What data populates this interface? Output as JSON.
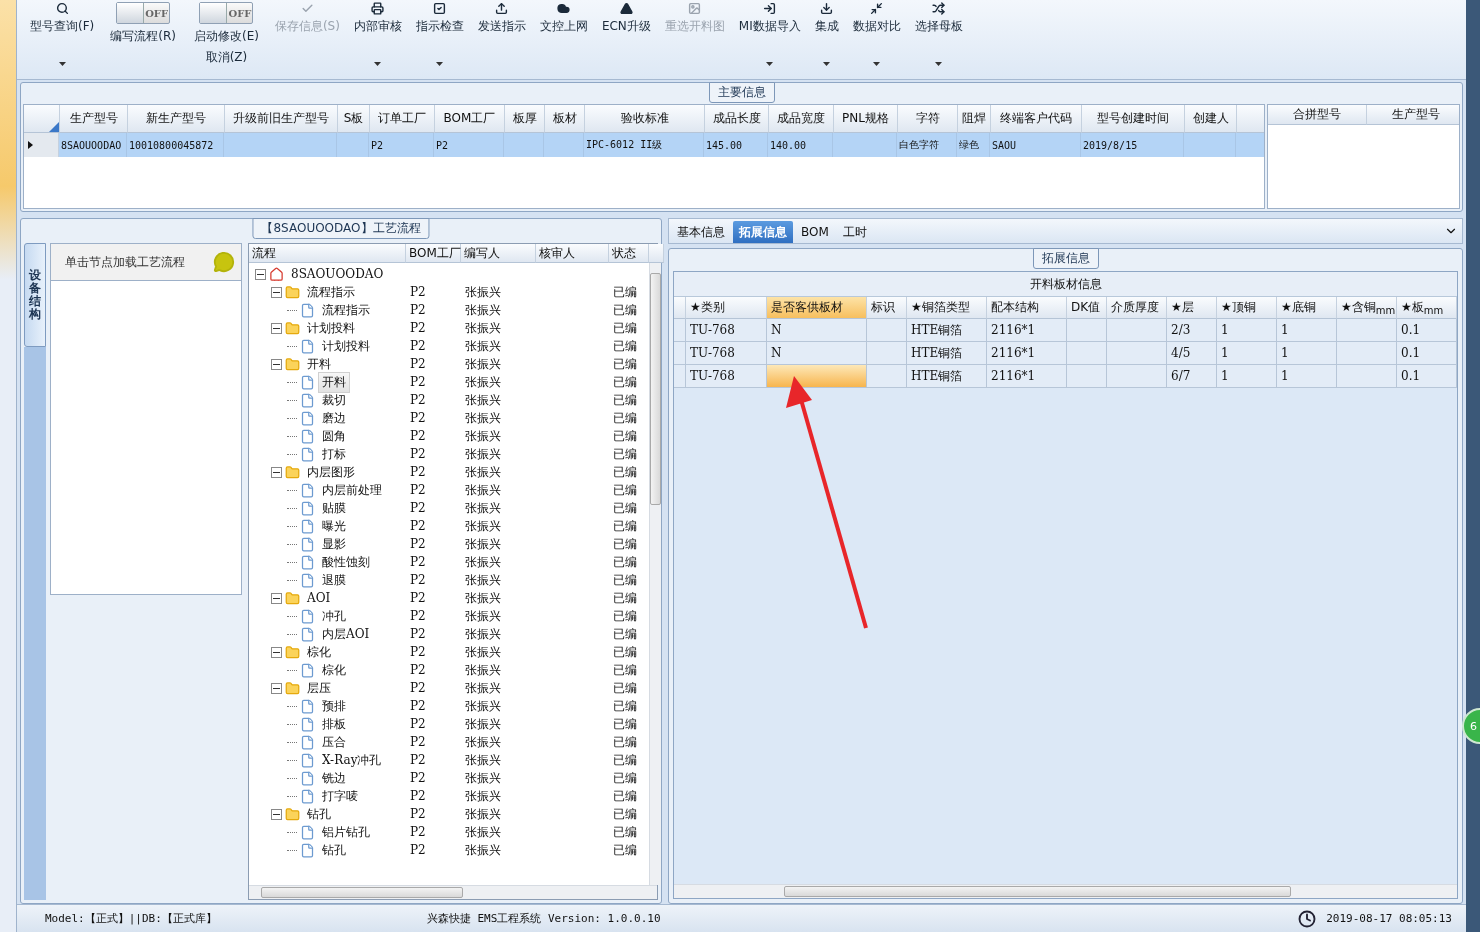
{
  "toolbar": [
    {
      "kind": "button",
      "label": "型号查询(F)",
      "disabled": false,
      "dropdown": true
    },
    {
      "kind": "toggle",
      "switch": "OFF",
      "on": false,
      "label": "编写流程(R)"
    },
    {
      "kind": "toggle",
      "switch": "OFF",
      "on": false,
      "label": "启动修改(E)",
      "label2": "取消(Z)"
    },
    {
      "kind": "button",
      "label": "保存信息(S)",
      "disabled": true,
      "dropdown": false
    },
    {
      "kind": "button",
      "label": "内部审核",
      "disabled": false,
      "dropdown": true
    },
    {
      "kind": "button",
      "label": "指示检查",
      "disabled": false,
      "dropdown": true
    },
    {
      "kind": "button",
      "label": "发送指示",
      "disabled": false,
      "dropdown": false
    },
    {
      "kind": "button",
      "label": "文控上网",
      "disabled": false,
      "dropdown": false
    },
    {
      "kind": "button",
      "label": "ECN升级",
      "disabled": false,
      "dropdown": false
    },
    {
      "kind": "button",
      "label": "重选开料图",
      "disabled": true,
      "dropdown": false
    },
    {
      "kind": "button",
      "label": "MI数据导入",
      "disabled": false,
      "dropdown": true
    },
    {
      "kind": "button",
      "label": "集成",
      "disabled": false,
      "dropdown": true
    },
    {
      "kind": "button",
      "label": "数据对比",
      "disabled": false,
      "dropdown": true
    },
    {
      "kind": "button",
      "label": "选择母板",
      "disabled": false,
      "dropdown": true
    }
  ],
  "main_info": {
    "title": "主要信息",
    "columns": [
      "生产型号",
      "新生产型号",
      "升级前旧生产型号",
      "S板",
      "订单工厂",
      "BOM工厂",
      "板厚",
      "板材",
      "验收标准",
      "成品长度",
      "成品宽度",
      "PNL规格",
      "字符",
      "阻焊",
      "终端客户代码",
      "型号创建时间",
      "创建人"
    ],
    "rows": [
      {
        "selected": true,
        "cells": [
          "8SAOUOODAO",
          "10010800045872",
          null,
          null,
          "P2",
          "P2",
          null,
          null,
          "IPC-6012 II级",
          "145.00",
          "140.00",
          null,
          "白色字符",
          "绿色",
          "SAOU",
          "2019/8/15",
          null
        ]
      }
    ],
    "side_table": {
      "columns": [
        "合拼型号",
        "生产型号"
      ]
    }
  },
  "process": {
    "title": "【8SAOUOODAO】工艺流程",
    "side_tab": {
      "label": "设备结构",
      "selected": true
    },
    "hint": "单击节点加载工艺流程",
    "columns": [
      "流程",
      "BOM工厂",
      "编写人",
      "核审人",
      "状态"
    ],
    "tree": [
      {
        "kind": "root",
        "name": "8SAOUOODAO",
        "expanded": true,
        "selected": false,
        "children": [
          {
            "kind": "folder",
            "name": "流程指示",
            "bom": "P2",
            "author": "张振兴",
            "status": "已编",
            "expanded": true,
            "selected": false,
            "children": [
              {
                "kind": "file",
                "name": "流程指示",
                "bom": "P2",
                "author": "张振兴",
                "status": "已编",
                "selected": false
              }
            ]
          },
          {
            "kind": "folder",
            "name": "计划投料",
            "bom": "P2",
            "author": "张振兴",
            "status": "已编",
            "expanded": true,
            "selected": false,
            "children": [
              {
                "kind": "file",
                "name": "计划投料",
                "bom": "P2",
                "author": "张振兴",
                "status": "已编",
                "selected": false
              }
            ]
          },
          {
            "kind": "folder",
            "name": "开料",
            "bom": "P2",
            "author": "张振兴",
            "status": "已编",
            "expanded": true,
            "selected": false,
            "children": [
              {
                "kind": "file",
                "name": "开料",
                "bom": "P2",
                "author": "张振兴",
                "status": "已编",
                "selected": true
              },
              {
                "kind": "file",
                "name": "裁切",
                "bom": "P2",
                "author": "张振兴",
                "status": "已编",
                "selected": false
              },
              {
                "kind": "file",
                "name": "磨边",
                "bom": "P2",
                "author": "张振兴",
                "status": "已编",
                "selected": false
              },
              {
                "kind": "file",
                "name": "圆角",
                "bom": "P2",
                "author": "张振兴",
                "status": "已编",
                "selected": false
              },
              {
                "kind": "file",
                "name": "打标",
                "bom": "P2",
                "author": "张振兴",
                "status": "已编",
                "selected": false
              }
            ]
          },
          {
            "kind": "folder",
            "name": "内层图形",
            "bom": "P2",
            "author": "张振兴",
            "status": "已编",
            "expanded": true,
            "selected": false,
            "children": [
              {
                "kind": "file",
                "name": "内层前处理",
                "bom": "P2",
                "author": "张振兴",
                "status": "已编",
                "selected": false
              },
              {
                "kind": "file",
                "name": "贴膜",
                "bom": "P2",
                "author": "张振兴",
                "status": "已编",
                "selected": false
              },
              {
                "kind": "file",
                "name": "曝光",
                "bom": "P2",
                "author": "张振兴",
                "status": "已编",
                "selected": false
              },
              {
                "kind": "file",
                "name": "显影",
                "bom": "P2",
                "author": "张振兴",
                "status": "已编",
                "selected": false
              },
              {
                "kind": "file",
                "name": "酸性蚀刻",
                "bom": "P2",
                "author": "张振兴",
                "status": "已编",
                "selected": false
              },
              {
                "kind": "file",
                "name": "退膜",
                "bom": "P2",
                "author": "张振兴",
                "status": "已编",
                "selected": false
              }
            ]
          },
          {
            "kind": "folder",
            "name": "AOI",
            "bom": "P2",
            "author": "张振兴",
            "status": "已编",
            "expanded": true,
            "selected": false,
            "children": [
              {
                "kind": "file",
                "name": "冲孔",
                "bom": "P2",
                "author": "张振兴",
                "status": "已编",
                "selected": false
              },
              {
                "kind": "file",
                "name": "内层AOI",
                "bom": "P2",
                "author": "张振兴",
                "status": "已编",
                "selected": false
              }
            ]
          },
          {
            "kind": "folder",
            "name": "棕化",
            "bom": "P2",
            "author": "张振兴",
            "status": "已编",
            "expanded": true,
            "selected": false,
            "children": [
              {
                "kind": "file",
                "name": "棕化",
                "bom": "P2",
                "author": "张振兴",
                "status": "已编",
                "selected": false
              }
            ]
          },
          {
            "kind": "folder",
            "name": "层压",
            "bom": "P2",
            "author": "张振兴",
            "status": "已编",
            "expanded": true,
            "selected": false,
            "children": [
              {
                "kind": "file",
                "name": "预排",
                "bom": "P2",
                "author": "张振兴",
                "status": "已编",
                "selected": false
              },
              {
                "kind": "file",
                "name": "排板",
                "bom": "P2",
                "author": "张振兴",
                "status": "已编",
                "selected": false
              },
              {
                "kind": "file",
                "name": "压合",
                "bom": "P2",
                "author": "张振兴",
                "status": "已编",
                "selected": false
              },
              {
                "kind": "file",
                "name": "X-Ray冲孔",
                "bom": "P2",
                "author": "张振兴",
                "status": "已编",
                "selected": false
              },
              {
                "kind": "file",
                "name": "铣边",
                "bom": "P2",
                "author": "张振兴",
                "status": "已编",
                "selected": false
              },
              {
                "kind": "file",
                "name": "打字唛",
                "bom": "P2",
                "author": "张振兴",
                "status": "已编",
                "selected": false
              }
            ]
          },
          {
            "kind": "folder",
            "name": "钻孔",
            "bom": "P2",
            "author": "张振兴",
            "status": "已编",
            "expanded": true,
            "selected": false,
            "children": [
              {
                "kind": "file",
                "name": "铝片钻孔",
                "bom": "P2",
                "author": "张振兴",
                "status": "已编",
                "selected": false
              },
              {
                "kind": "file",
                "name": "钻孔",
                "bom": "P2",
                "author": "张振兴",
                "status": "已编",
                "selected": false
              }
            ]
          }
        ]
      }
    ]
  },
  "detail": {
    "tabs": [
      {
        "label": "基本信息",
        "selected": false
      },
      {
        "label": "拓展信息",
        "selected": true
      },
      {
        "label": "BOM",
        "selected": false
      },
      {
        "label": "工时",
        "selected": false
      }
    ],
    "group_title": "拓展信息",
    "table_title": "开料板材信息",
    "columns": [
      {
        "label": "★类别",
        "selected": false
      },
      {
        "label": "是否客供板材",
        "selected": true
      },
      {
        "label": "标识",
        "selected": false
      },
      {
        "label": "★铜箔类型",
        "selected": false
      },
      {
        "label": "配本结构",
        "selected": false
      },
      {
        "label": "DK值",
        "selected": false
      },
      {
        "label": "介质厚度",
        "selected": false
      },
      {
        "label": "★层",
        "selected": false
      },
      {
        "label": "★顶铜",
        "selected": false
      },
      {
        "label": "★底铜",
        "selected": false
      },
      {
        "label": "★含铜$_{mm}$",
        "selected": false
      },
      {
        "label": "★板$_{mm}$",
        "selected": false
      }
    ],
    "rows": [
      {
        "selected": false,
        "cells": [
          "TU-768",
          "N",
          null,
          "HTE铜箔",
          "2116*1",
          null,
          null,
          "2/3",
          "1",
          "1",
          null,
          "0.1"
        ]
      },
      {
        "selected": false,
        "cells": [
          "TU-768",
          "N",
          null,
          "HTE铜箔",
          "2116*1",
          null,
          null,
          "4/5",
          "1",
          "1",
          null,
          "0.1"
        ]
      },
      {
        "selected": true,
        "cells": [
          "TU-768",
          null,
          null,
          "HTE铜箔",
          "2116*1",
          null,
          null,
          "6/7",
          "1",
          "1",
          null,
          "0.1"
        ]
      }
    ]
  },
  "floating_badge": "6",
  "status_bar": {
    "mode": "Model:【正式】||DB:【正式库】",
    "product": "兴森快捷 EMS工程系统 Version: 1.0.0.10",
    "time": "2019-08-17 08:05:13"
  }
}
